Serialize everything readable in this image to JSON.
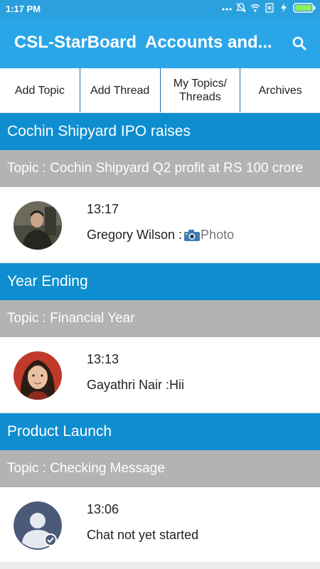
{
  "status_bar": {
    "time": "1:17 PM",
    "icons": [
      "more-dots-icon",
      "mute-bell-icon",
      "wifi-icon",
      "no-sim-icon",
      "charging-icon",
      "battery-icon"
    ]
  },
  "app_bar": {
    "title": "CSL-StarBoard",
    "subtitle": "Accounts and...",
    "search_icon": "search-icon"
  },
  "tabs": [
    {
      "label": "Add Topic"
    },
    {
      "label": "Add Thread"
    },
    {
      "label": "My Topics/\nThreads"
    },
    {
      "label": "Archives"
    }
  ],
  "colors": {
    "status_bar": "#2aa0df",
    "app_bar": "#2aa6e8",
    "group_header": "#0e8ecf",
    "topic_row": "#b3b3b3"
  },
  "groups": [
    {
      "header": "Cochin Shipyard IPO raises",
      "topic": "Topic : Cochin Shipyard Q2 profit at RS 100 crore",
      "thread": {
        "time": "13:17",
        "sender": "Gregory Wilson : ",
        "message": "Photo",
        "message_icon": "camera-icon",
        "avatar": "photo-man"
      }
    },
    {
      "header": "Year Ending",
      "topic": "Topic : Financial Year",
      "thread": {
        "time": "13:13",
        "sender": "Gayathri Nair : ",
        "message": "Hii",
        "avatar": "photo-woman"
      }
    },
    {
      "header": "Product Launch",
      "topic": "Topic : Checking Message",
      "thread": {
        "time": "13:06",
        "sender": "",
        "message": "Chat not yet started",
        "avatar": "default-user"
      }
    }
  ]
}
